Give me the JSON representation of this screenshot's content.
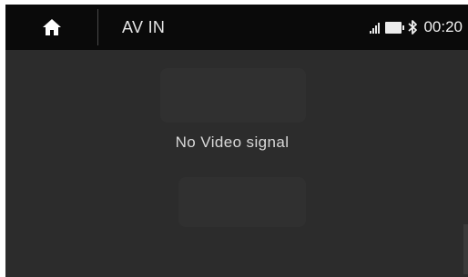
{
  "header": {
    "title": "AV IN",
    "home_icon": "home-icon",
    "status": {
      "signal_icon": "signal-bars-icon",
      "battery_icon": "battery-icon",
      "bluetooth_icon": "bluetooth-icon",
      "time": "00:20"
    }
  },
  "main": {
    "message": "No Video signal"
  },
  "colors": {
    "topbar": "#0a0a0a",
    "background": "#2c2c2c",
    "text": "#e6e6e6"
  }
}
